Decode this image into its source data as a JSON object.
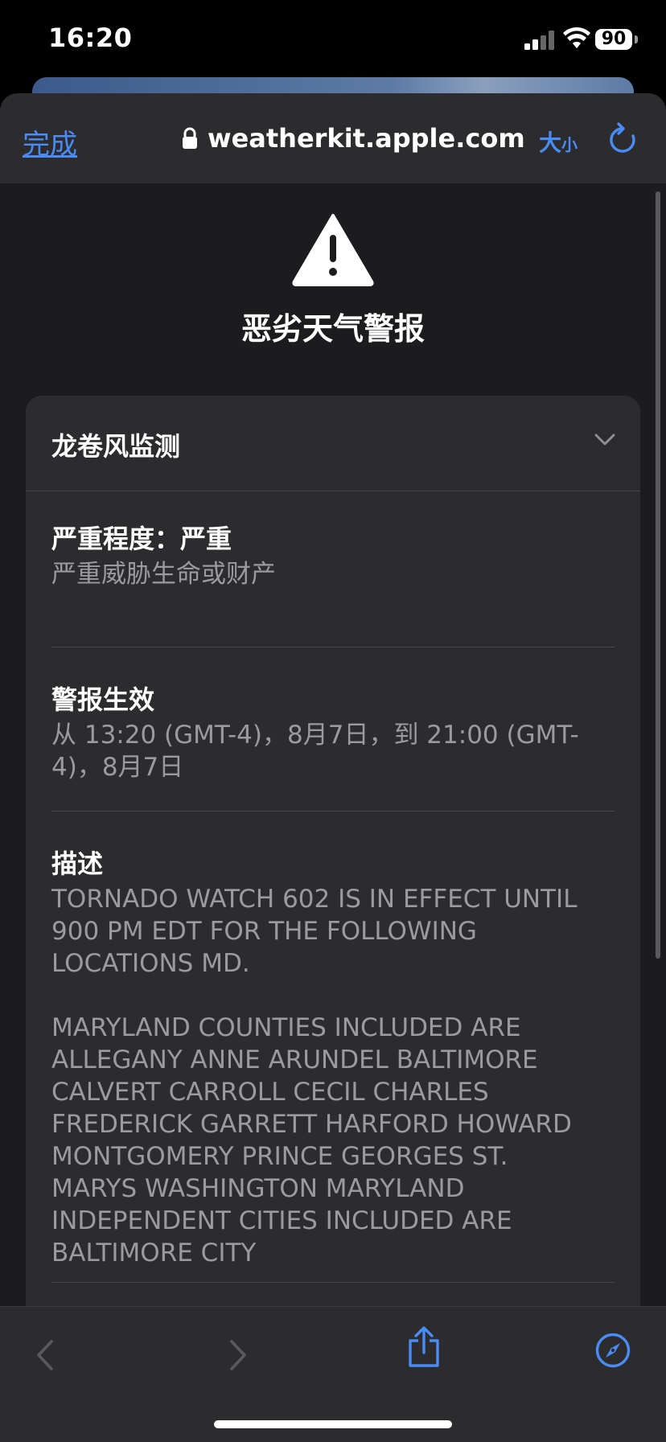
{
  "status_bar": {
    "time": "16:20",
    "battery": "90"
  },
  "browser": {
    "done_label": "完成",
    "url": "weatherkit.apple.com",
    "size_label_main": "大",
    "size_label_small": "小"
  },
  "page": {
    "title": "恶劣天气警报",
    "alert": {
      "header": "龙卷风监测",
      "sections": [
        {
          "label": "严重程度：严重",
          "value": "严重威胁生命或财产"
        },
        {
          "label": "警报生效",
          "value": "从 13:20 (GMT-4)，8月7日，到 21:00 (GMT-\n4)，8月7日"
        },
        {
          "label": "描述",
          "value": "TORNADO WATCH 602 IS IN EFFECT UNTIL\n900 PM EDT FOR THE FOLLOWING\nLOCATIONS MD.\n\nMARYLAND COUNTIES INCLUDED ARE\nALLEGANY ANNE ARUNDEL BALTIMORE\nCALVERT CARROLL CECIL CHARLES\nFREDERICK GARRETT HARFORD HOWARD\nMONTGOMERY PRINCE GEORGES ST.\nMARYS WASHINGTON MARYLAND\nINDEPENDENT CITIES INCLUDED ARE\nBALTIMORE CITY"
        }
      ]
    }
  },
  "icons": {
    "signal": "cellular-signal-icon",
    "wifi": "wifi-icon",
    "lock": "lock-icon",
    "reload": "reload-icon",
    "warning": "warning-triangle-icon",
    "chevron": "chevron-down-icon",
    "back": "back-arrow-icon",
    "forward": "forward-arrow-icon",
    "share": "share-icon",
    "compass": "compass-icon"
  },
  "colors": {
    "accent": "#4a8cf7",
    "background": "#1c1c1e",
    "card": "#2c2c2e",
    "secondary_text": "#9a9aa0"
  }
}
